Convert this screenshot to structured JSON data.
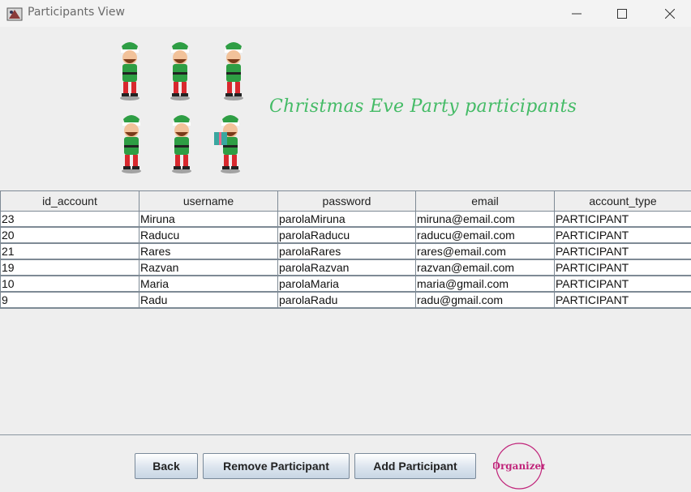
{
  "window": {
    "title": "Participants View",
    "minimize_icon": "minimize-icon",
    "maximize_icon": "maximize-icon",
    "close_icon": "close-icon"
  },
  "banner": {
    "heading": "Christmas Eve Party participants",
    "heading_color": "#44bb66",
    "image": "six-christmas-elves-illustration"
  },
  "table": {
    "columns": [
      "id_account",
      "username",
      "password",
      "email",
      "account_type"
    ],
    "rows": [
      [
        "23",
        "Miruna",
        "parolaMiruna",
        "miruna@email.com",
        "PARTICIPANT"
      ],
      [
        "20",
        "Raducu",
        "parolaRaducu",
        "raducu@email.com",
        "PARTICIPANT"
      ],
      [
        "21",
        "Rares",
        "parolaRares",
        "rares@email.com",
        "PARTICIPANT"
      ],
      [
        "19",
        "Razvan",
        "parolaRazvan",
        "razvan@email.com",
        "PARTICIPANT"
      ],
      [
        "10",
        "Maria",
        "parolaMaria",
        "maria@gmail.com",
        "PARTICIPANT"
      ],
      [
        "9",
        "Radu",
        "parolaRadu",
        "radu@gmail.com",
        "PARTICIPANT"
      ]
    ]
  },
  "buttons": {
    "back": "Back",
    "remove": "Remove Participant",
    "add": "Add Participant"
  },
  "logo": {
    "text": "Organizer",
    "color": "#c0247a"
  }
}
